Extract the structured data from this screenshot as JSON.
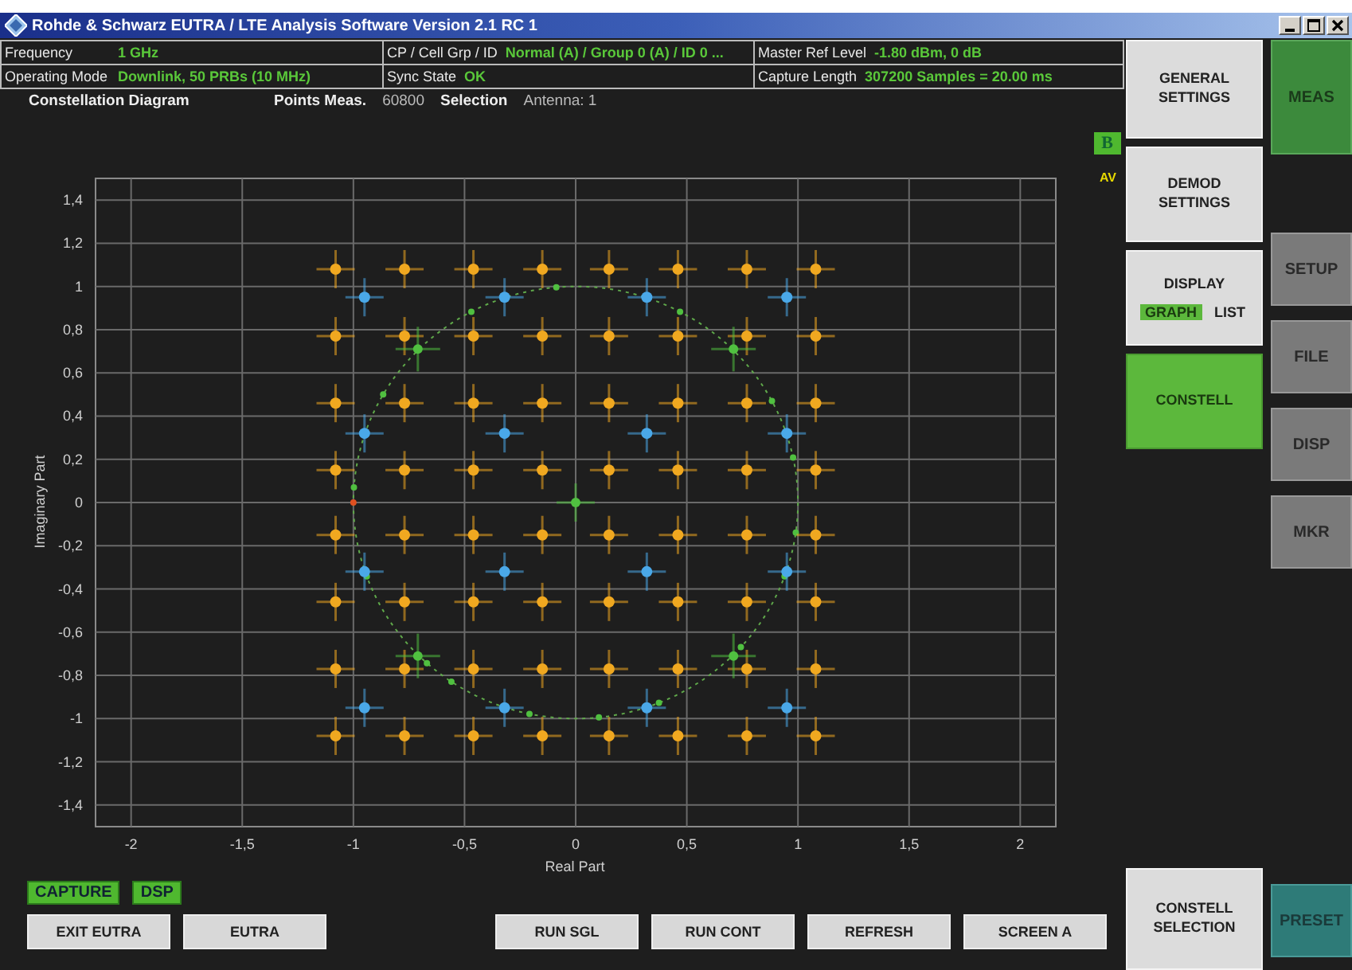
{
  "window": {
    "title": "Rohde & Schwarz EUTRA / LTE Analysis Software Version 2.1 RC 1"
  },
  "info": [
    {
      "label": "Frequency",
      "value": "1 GHz"
    },
    {
      "label": "CP / Cell Grp / ID",
      "value": "Normal (A) / Group 0 (A) / ID 0 ..."
    },
    {
      "label": "Master Ref Level",
      "value": "-1.80 dBm, 0 dB"
    },
    {
      "label": "Operating Mode",
      "value": "Downlink, 50 PRBs (10 MHz)"
    },
    {
      "label": "Sync State",
      "value": "OK"
    },
    {
      "label": "Capture Length",
      "value": "307200 Samples = 20.00 ms"
    }
  ],
  "header": {
    "title": "Constellation Diagram",
    "points_label": "Points Meas.",
    "points_value": "60800",
    "selection_label": "Selection",
    "selection_value": "Antenna: 1"
  },
  "trace_badge": "B",
  "trace_mode": "AV",
  "chart_data": {
    "type": "scatter",
    "grid": true,
    "xlabel": "Real Part",
    "ylabel": "Imaginary Part",
    "xlim": [
      -2.16,
      2.16
    ],
    "ylim": [
      -1.5,
      1.5
    ],
    "xticks": [
      -2,
      {
        "value": -1.5,
        "label": "-1,5"
      },
      -1,
      {
        "value": -0.5,
        "label": "-0,5"
      },
      0,
      {
        "value": 0.5,
        "label": "0,5"
      },
      1,
      {
        "value": 1.5,
        "label": "1,5"
      },
      2
    ],
    "yticks": [
      {
        "value": 1.4,
        "label": "1,4"
      },
      {
        "value": 1.2,
        "label": "1,2"
      },
      1,
      {
        "value": 0.8,
        "label": "0,8"
      },
      {
        "value": 0.6,
        "label": "0,6"
      },
      {
        "value": 0.4,
        "label": "0,4"
      },
      {
        "value": 0.2,
        "label": "0,2"
      },
      0,
      {
        "value": -0.2,
        "label": "-0,2"
      },
      {
        "value": -0.4,
        "label": "-0,4"
      },
      {
        "value": -0.6,
        "label": "-0,6"
      },
      {
        "value": -0.8,
        "label": "-0,8"
      },
      -1,
      {
        "value": -1.2,
        "label": "-1,2"
      },
      {
        "value": -1.4,
        "label": "-1,4"
      }
    ],
    "series": [
      {
        "color": "#f0a820",
        "x": [
          -1.08,
          -0.77,
          -0.46,
          -0.15,
          0.15,
          0.46,
          0.77,
          1.08,
          -1.08,
          -0.77,
          -0.46,
          -0.15,
          0.15,
          0.46,
          0.77,
          1.08,
          -1.08,
          -0.77,
          -0.46,
          -0.15,
          0.15,
          0.46,
          0.77,
          1.08,
          -1.08,
          -0.77,
          -0.46,
          -0.15,
          0.15,
          0.46,
          0.77,
          1.08,
          -1.08,
          -0.77,
          -0.46,
          -0.15,
          0.15,
          0.46,
          0.77,
          1.08,
          -1.08,
          -0.77,
          -0.46,
          -0.15,
          0.15,
          0.46,
          0.77,
          1.08,
          -1.08,
          -0.77,
          -0.46,
          -0.15,
          0.15,
          0.46,
          0.77,
          1.08,
          -1.08,
          -0.77,
          -0.46,
          -0.15,
          0.15,
          0.46,
          0.77,
          1.08
        ],
        "values": [
          1.08,
          1.08,
          1.08,
          1.08,
          1.08,
          1.08,
          1.08,
          1.08,
          0.77,
          0.77,
          0.77,
          0.77,
          0.77,
          0.77,
          0.77,
          0.77,
          0.46,
          0.46,
          0.46,
          0.46,
          0.46,
          0.46,
          0.46,
          0.46,
          0.15,
          0.15,
          0.15,
          0.15,
          0.15,
          0.15,
          0.15,
          0.15,
          -0.15,
          -0.15,
          -0.15,
          -0.15,
          -0.15,
          -0.15,
          -0.15,
          -0.15,
          -0.46,
          -0.46,
          -0.46,
          -0.46,
          -0.46,
          -0.46,
          -0.46,
          -0.46,
          -0.77,
          -0.77,
          -0.77,
          -0.77,
          -0.77,
          -0.77,
          -0.77,
          -0.77,
          -1.08,
          -1.08,
          -1.08,
          -1.08,
          -1.08,
          -1.08,
          -1.08,
          -1.08
        ]
      },
      {
        "color": "#4aa8e8",
        "x": [
          -0.95,
          -0.32,
          0.32,
          0.95,
          -0.95,
          -0.32,
          0.32,
          0.95,
          -0.95,
          -0.32,
          0.32,
          0.95,
          -0.95,
          -0.32,
          0.32,
          0.95
        ],
        "values": [
          0.95,
          0.95,
          0.95,
          0.95,
          0.32,
          0.32,
          0.32,
          0.32,
          -0.32,
          -0.32,
          -0.32,
          -0.32,
          -0.95,
          -0.95,
          -0.95,
          -0.95
        ]
      },
      {
        "color": "#50c040",
        "x": [
          -0.71,
          0.71,
          -0.71,
          0.71,
          0
        ],
        "values": [
          0.71,
          0.71,
          -0.71,
          -0.71,
          0
        ]
      }
    ]
  },
  "status_indicators": [
    "CAPTURE",
    "DSP"
  ],
  "bottom_buttons": [
    {
      "label": "EXIT EUTRA",
      "kind": "button"
    },
    {
      "label": "EUTRA",
      "kind": "button"
    },
    {
      "kind": "gap"
    },
    {
      "label": "RUN SGL",
      "kind": "button"
    },
    {
      "label": "RUN CONT",
      "kind": "button"
    },
    {
      "label": "REFRESH",
      "kind": "button"
    },
    {
      "label": "SCREEN A",
      "kind": "button"
    }
  ],
  "softkeys": [
    {
      "label": "GENERAL SETTINGS",
      "selected": false
    },
    {
      "label": "DEMOD SETTINGS",
      "selected": false
    },
    {
      "label": "DISPLAY",
      "selected": false,
      "options": [
        {
          "label": "GRAPH",
          "selected": true
        },
        {
          "label": "LIST",
          "selected": false
        }
      ]
    },
    {
      "label": "CONSTELL",
      "selected": true
    }
  ],
  "bottom_softkey": {
    "label": "CONSTELL SELECTION",
    "selected": false
  },
  "hardkeys": [
    {
      "label": "MEAS",
      "selected": true
    },
    {
      "label": "SETUP",
      "selected": false
    },
    {
      "label": "FILE",
      "selected": false
    },
    {
      "label": "DISP",
      "selected": false
    },
    {
      "label": "MKR",
      "selected": false
    }
  ],
  "preset_button": "PRESET"
}
